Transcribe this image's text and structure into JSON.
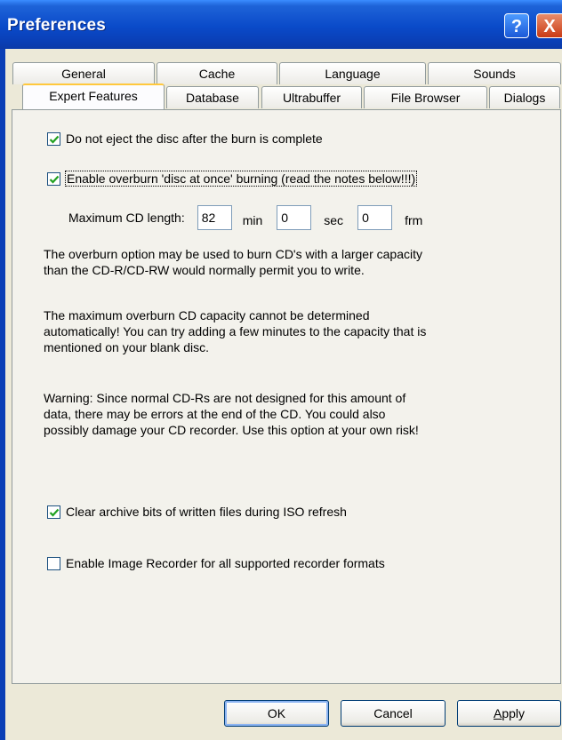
{
  "window": {
    "title": "Preferences",
    "help_glyph": "?",
    "close_glyph": "X"
  },
  "tabs": {
    "back_row": [
      "General",
      "Cache",
      "Language",
      "Sounds"
    ],
    "front_row": [
      "Expert Features",
      "Database",
      "Ultrabuffer",
      "File Browser",
      "Dialogs"
    ],
    "selected": "Expert Features"
  },
  "options": {
    "no_eject": {
      "label": "Do not eject the disc after the burn is complete",
      "checked": true
    },
    "overburn": {
      "label": "Enable overburn 'disc at once' burning (read the notes below!!!)",
      "checked": true
    },
    "clear_archive": {
      "label": "Clear archive bits of written files during ISO refresh",
      "checked": true
    },
    "image_recorder": {
      "label": "Enable Image Recorder for all supported recorder formats",
      "checked": false
    }
  },
  "max_length": {
    "label": "Maximum CD length:",
    "min_value": "82",
    "min_unit": "min",
    "sec_value": "0",
    "sec_unit": "sec",
    "frm_value": "0",
    "frm_unit": "frm"
  },
  "notes": {
    "p1_l1": "The overburn option may be used to burn CD's with a larger capacity",
    "p1_l2": "than the CD-R/CD-RW would normally permit you to write.",
    "p2_l1": "The maximum overburn CD capacity cannot be determined",
    "p2_l2": "automatically! You can try adding a few minutes to the capacity that is",
    "p2_l3": "mentioned on your blank disc.",
    "p3_l1": "Warning: Since normal CD-Rs are not designed for this amount of",
    "p3_l2": "data, there may be errors at the end of the CD. You could also",
    "p3_l3": "possibly damage your CD recorder. Use this option at your own risk!"
  },
  "buttons": {
    "ok": "OK",
    "cancel": "Cancel",
    "apply_first": "A",
    "apply_rest": "pply"
  },
  "colors": {
    "titlebar": "#0A4AC9",
    "dialog_bg": "#ECE9D8",
    "selected_tab_accent": "#FFC83C",
    "check": "#21A121"
  }
}
